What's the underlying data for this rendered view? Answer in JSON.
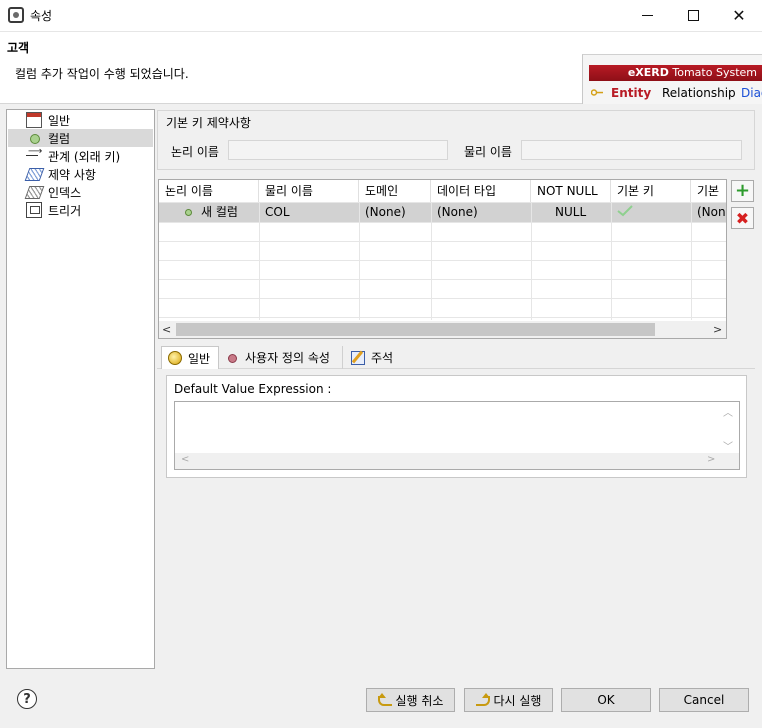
{
  "window": {
    "title": "속성",
    "minimize_label": "Minimize",
    "maximize_label": "Maximize",
    "close_label": "✕"
  },
  "header": {
    "title": "고객",
    "message": "컬럼 추가 작업이 수행 되었습니다.",
    "banner": {
      "brand_bold": "eXERD",
      "brand_rest": "Tomato System",
      "tabs": [
        "Entity",
        "Relationship",
        "Diag"
      ]
    }
  },
  "sidebar": {
    "items": [
      {
        "label": "일반",
        "icon": "table-icon"
      },
      {
        "label": "컬럼",
        "icon": "column-icon"
      },
      {
        "label": "관계 (외래 키)",
        "icon": "relationship-icon"
      },
      {
        "label": "제약 사항",
        "icon": "constraint-icon"
      },
      {
        "label": "인덱스",
        "icon": "index-icon"
      },
      {
        "label": "트리거",
        "icon": "trigger-icon"
      }
    ],
    "selected_index": 1
  },
  "pk_group": {
    "legend": "기본 키 제약사항",
    "logical_label": "논리 이름",
    "logical_value": "",
    "physical_label": "물리 이름",
    "physical_value": ""
  },
  "columns_grid": {
    "headers": [
      "논리 이름",
      "물리 이름",
      "도메인",
      "데이터 타입",
      "NOT NULL",
      "기본 키",
      "기본"
    ],
    "rows": [
      {
        "logical": "새 컬럼",
        "physical": "COL",
        "domain": "(None)",
        "data_type": "(None)",
        "not_null": "NULL",
        "primary_key": true,
        "default": "(None"
      }
    ],
    "add_label": "+",
    "delete_label": "✖"
  },
  "detail_tabs": {
    "tabs": [
      "일반",
      "사용자 정의 속성",
      "주석"
    ],
    "active": 0,
    "default_value_label": "Default Value Expression :",
    "default_value": ""
  },
  "footer": {
    "help_label": "?",
    "undo_label": "실행 취소",
    "redo_label": "다시 실행",
    "ok_label": "OK",
    "cancel_label": "Cancel"
  },
  "colors": {
    "brand": "#b81b25",
    "link": "#1a4fd6",
    "selected_row": "#d2d2d2",
    "add": "#2d9b2d",
    "delete": "#d62020"
  }
}
